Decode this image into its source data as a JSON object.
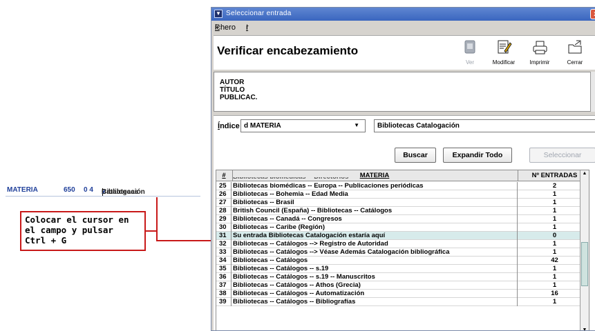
{
  "annotation": {
    "field_name": "MATERIA",
    "field_tag": "650",
    "indicators": "0 4",
    "field_value_a": "Bibliotecas",
    "field_value_sub": "x",
    "field_value_b": "Catalogación",
    "callout_text": "Colocar el cursor en\nel campo y pulsar\nCtrl + G"
  },
  "window": {
    "title": "Seleccionar entrada",
    "close_glyph": "x",
    "menu": [
      {
        "first": "F",
        "rest": "ichero"
      },
      {
        "first": "I",
        "rest": "r"
      }
    ],
    "header_title": "Verificar encabezamiento",
    "toolbar": [
      {
        "label": "Ver",
        "icon": "view-icon",
        "disabled": true
      },
      {
        "label": "Modificar",
        "icon": "edit-icon",
        "disabled": false
      },
      {
        "label": "Imprimir",
        "icon": "print-icon",
        "disabled": false
      },
      {
        "label": "Cerrar",
        "icon": "close-folder-icon",
        "disabled": false
      }
    ],
    "info_lines": [
      "AUTOR",
      "TÍTULO",
      "PUBLICAC."
    ],
    "index_label_first": "Í",
    "index_label_rest": "ndice",
    "index_select_value": "d MATERIA",
    "search_value": "Bibliotecas Catalogación",
    "buttons": {
      "buscar": "Buscar",
      "expandir": "Expandir Todo",
      "seleccionar": "Seleccionar"
    }
  },
  "table": {
    "headers": {
      "num": "#",
      "materia": "MATERIA",
      "entradas": "Nº ENTRADAS"
    },
    "clipped_row_text": "Bibliotecas biomédicas -- Directorios",
    "rows": [
      {
        "num": "25",
        "materia": "Bibliotecas biomédicas -- Europa -- Publicaciones periódicas",
        "entradas": "2"
      },
      {
        "num": "26",
        "materia": "Bibliotecas -- Bohemia -- Edad Media",
        "entradas": "1"
      },
      {
        "num": "27",
        "materia": "Bibliotecas -- Brasil",
        "entradas": "1"
      },
      {
        "num": "28",
        "materia": "British Council (España) -- Bibliotecas -- Catálogos",
        "entradas": "1"
      },
      {
        "num": "29",
        "materia": "Bibliotecas -- Canadá -- Congresos",
        "entradas": "1"
      },
      {
        "num": "30",
        "materia": "Bibliotecas -- Caribe (Región)",
        "entradas": "1"
      },
      {
        "num": "31",
        "materia": "Su entrada Bibliotecas Catalogación estaría aquí",
        "entradas": "0",
        "selected": true
      },
      {
        "num": "32",
        "materia": "Bibliotecas -- Catálogos --> Registro de Autoridad",
        "entradas": "1"
      },
      {
        "num": "33",
        "materia": "Bibliotecas -- Catálogos --> Véase Además Catalogación bibliográfica",
        "entradas": "1"
      },
      {
        "num": "34",
        "materia": "Bibliotecas -- Catálogos",
        "entradas": "42"
      },
      {
        "num": "35",
        "materia": "Bibliotecas -- Catálogos -- s.19",
        "entradas": "1"
      },
      {
        "num": "36",
        "materia": "Bibliotecas -- Catálogos -- s.19 -- Manuscritos",
        "entradas": "1"
      },
      {
        "num": "37",
        "materia": "Bibliotecas -- Catálogos -- Athos (Grecia)",
        "entradas": "1"
      },
      {
        "num": "38",
        "materia": "Bibliotecas -- Catálogos -- Automatización",
        "entradas": "16"
      },
      {
        "num": "39",
        "materia": "Bibliotecas -- Catálogos -- Bibliografías",
        "entradas": "1"
      }
    ]
  },
  "colors": {
    "callout_border": "#c81818",
    "selected_row": "#d7ebeb",
    "titlebar": "#3a66bf"
  }
}
